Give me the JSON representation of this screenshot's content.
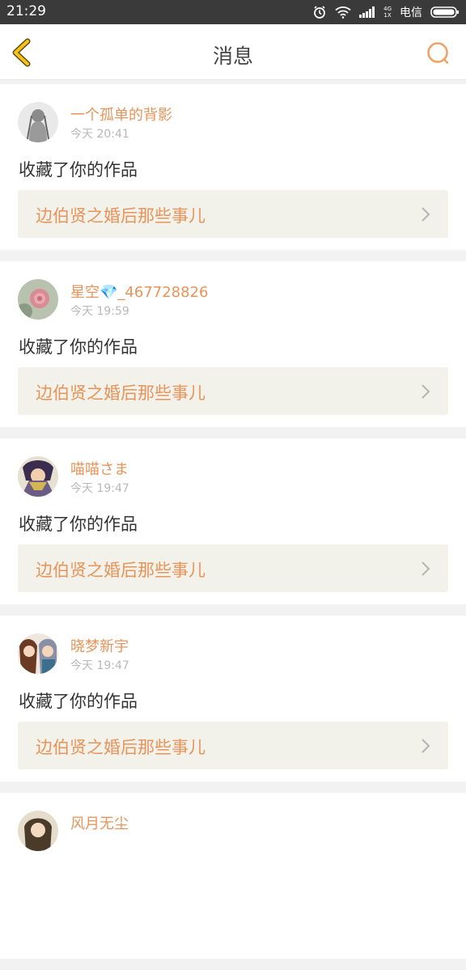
{
  "status_bar": {
    "time": "21:29",
    "network_top": "4G",
    "network_bottom": "1X",
    "carrier": "电信"
  },
  "header": {
    "title": "消息",
    "back_icon": "chevron-left-icon",
    "search_icon": "search-icon"
  },
  "colors": {
    "accent": "#e8935a",
    "header_bg": "#ffffff",
    "status_bar_bg": "#3a3a3a",
    "link_bg": "#f2f2ea",
    "page_bg": "#f2f2f2"
  },
  "messages": [
    {
      "username": "一个孤单的背影",
      "time": "今天 20:41",
      "action": "收藏了你的作品",
      "work_title": "边伯贤之婚后那些事儿"
    },
    {
      "username": "星空💎_467728826",
      "time": "今天 19:59",
      "action": "收藏了你的作品",
      "work_title": "边伯贤之婚后那些事儿"
    },
    {
      "username": "喵喵さま",
      "time": "今天 19:47",
      "action": "收藏了你的作品",
      "work_title": "边伯贤之婚后那些事儿"
    },
    {
      "username": "晓梦新宇",
      "time": "今天 19:47",
      "action": "收藏了你的作品",
      "work_title": "边伯贤之婚后那些事儿"
    },
    {
      "username": "风月无尘",
      "time": "",
      "action": "",
      "work_title": ""
    }
  ]
}
